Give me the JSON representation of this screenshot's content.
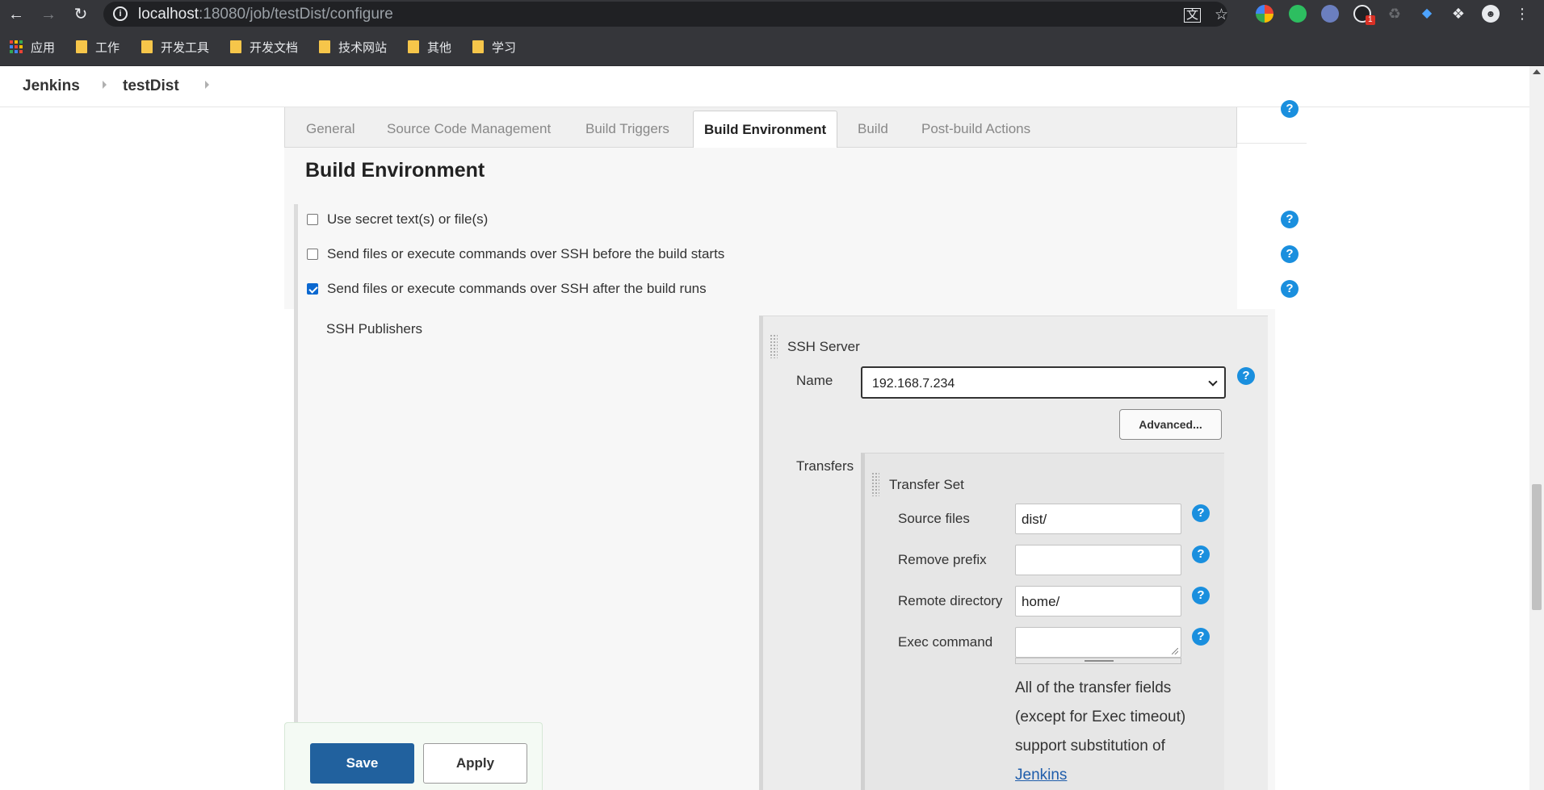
{
  "browser": {
    "url_host": "localhost",
    "url_port_path": ":18080/job/testDist/configure",
    "bookmarks": [
      {
        "label": "应用",
        "icon": "apps-grid-icon"
      },
      {
        "label": "工作",
        "icon": "folder-icon"
      },
      {
        "label": "开发工具",
        "icon": "folder-icon"
      },
      {
        "label": "开发文档",
        "icon": "folder-icon"
      },
      {
        "label": "技术网站",
        "icon": "folder-icon"
      },
      {
        "label": "其他",
        "icon": "folder-icon"
      },
      {
        "label": "学习",
        "icon": "folder-icon"
      }
    ],
    "extension_badge": "1"
  },
  "breadcrumbs": [
    "Jenkins",
    "testDist"
  ],
  "tabs": [
    "General",
    "Source Code Management",
    "Build Triggers",
    "Build Environment",
    "Build",
    "Post-build Actions"
  ],
  "active_tab": "Build Environment",
  "section_title": "Build Environment",
  "options": [
    {
      "label": "Use secret text(s) or file(s)",
      "checked": false
    },
    {
      "label": "Send files or execute commands over SSH before the build starts",
      "checked": false
    },
    {
      "label": "Send files or execute commands over SSH after the build runs",
      "checked": true
    }
  ],
  "ssh": {
    "publishers_label": "SSH Publishers",
    "server_label": "SSH Server",
    "name_label": "Name",
    "name_value": "192.168.7.234",
    "advanced_label": "Advanced...",
    "transfers_label": "Transfers",
    "transfer_set_label": "Transfer Set",
    "fields": {
      "source_files_label": "Source files",
      "source_files_value": "dist/",
      "remove_prefix_label": "Remove prefix",
      "remove_prefix_value": "",
      "remote_dir_label": "Remote directory",
      "remote_dir_value": "home/",
      "exec_command_label": "Exec command",
      "exec_command_value": ""
    },
    "note_text": "All of the transfer fields (except for Exec timeout) support substitution of ",
    "note_link": "Jenkins"
  },
  "buttons": {
    "save": "Save",
    "apply": "Apply"
  },
  "help_symbol": "?",
  "colors": {
    "primary_button": "#21619e",
    "help_icon": "#1a8fde",
    "checkbox_checked": "#0b68d0"
  }
}
